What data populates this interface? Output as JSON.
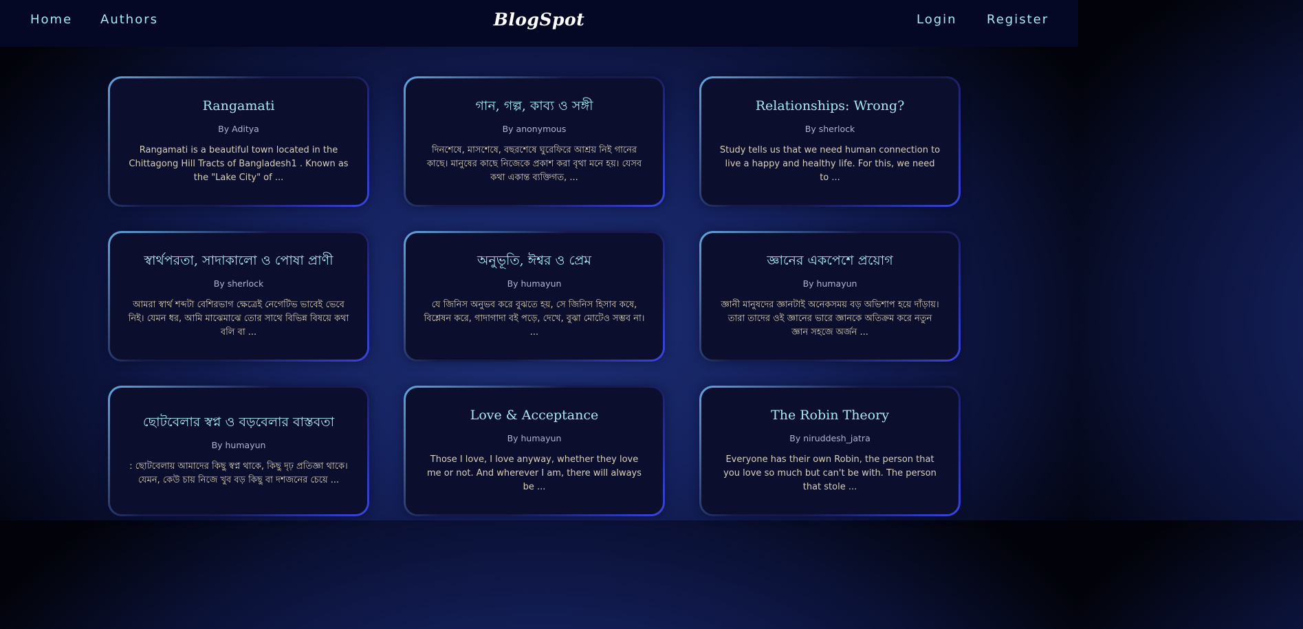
{
  "nav": {
    "home": "Home",
    "authors": "Authors",
    "brand": "BlogSpot",
    "login": "Login",
    "register": "Register"
  },
  "posts": [
    {
      "title": "Rangamati",
      "author": "By Aditya",
      "excerpt": "Rangamati is a beautiful town located in the Chittagong Hill Tracts of Bangladesh1 . Known as the \"Lake City\" of ..."
    },
    {
      "title": "গান, গল্প, কাব্য ও সঙ্গী",
      "author": "By anonymous",
      "excerpt": "দিনশেষে, মাসশেষে, বছরশেষে ঘুরেফিরে আশ্রয় নিই গানের কাছে। মানুষের কাছে নিজেকে প্রকাশ করা বৃথা মনে হয়। যেসব কথা একান্ত ব্যক্তিগত, ..."
    },
    {
      "title": "Relationships: Wrong?",
      "author": "By sherlock",
      "excerpt": "Study tells us that we need human connection to live a happy and healthy life. For this, we need to ..."
    },
    {
      "title": "স্বার্থপরতা, সাদাকালো ও পোষা প্রাণী",
      "author": "By sherlock",
      "excerpt": "আমরা স্বার্থ শব্দটা বেশিরভাগ ক্ষেত্রেই নেগেটিভ ভাবেই ভেবে নিই। যেমন ধর, আমি মাঝেমাঝে তোর সাথে বিভিন্ন বিষয়ে কথা বলি বা ..."
    },
    {
      "title": "অনুভূতি, ঈশ্বর ও প্রেম",
      "author": "By humayun",
      "excerpt": "যে জিনিস অনুভব করে বুঝতে হয়, সে জিনিস হিসাব কষে, বিশ্লেষন করে, গাদাগাদা বই পড়ে, দেখে, বুঝা মোটেও সম্ভব না। ..."
    },
    {
      "title": "জ্ঞানের একপেশে প্রয়োগ",
      "author": "By humayun",
      "excerpt": "জ্ঞানী মানুষদের জ্ঞানটাই অনেকসময় বড় অভিশাপ হয়ে দাঁড়ায়। তারা তাদের ওই জ্ঞানের ভারে জ্ঞানকে অতিক্রম করে নতুন জ্ঞান সহজে অর্জন ..."
    },
    {
      "title": "ছোটবেলার স্বপ্ন ও বড়বেলার বাস্তবতা",
      "author": "By humayun",
      "excerpt": ": ছোটবেলায় আমাদের কিছু স্বপ্ন থাকে, কিছু দৃঢ় প্রতিজ্ঞা থাকে। যেমন, কেউ চায় নিজে খুব বড় কিছু বা দশজনের চেয়ে ..."
    },
    {
      "title": "Love & Acceptance",
      "author": "By humayun",
      "excerpt": "Those I love, I love anyway, whether they love me or not. And wherever I am, there will always be ..."
    },
    {
      "title": "The Robin Theory",
      "author": "By niruddesh_jatra",
      "excerpt": "Everyone has their own Robin, the person that you love so much but can't be with. The person that stole ..."
    }
  ]
}
